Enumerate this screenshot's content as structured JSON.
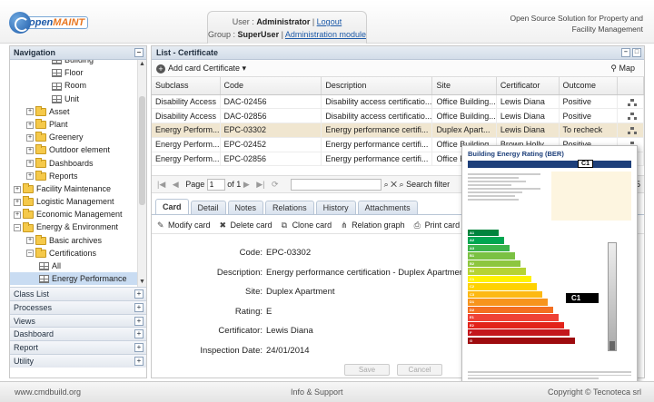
{
  "header": {
    "logo_text_a": "open",
    "logo_text_b": "MAINT",
    "user_label": "User :",
    "user_name": "Administrator",
    "logout": "Logout",
    "group_label": "Group :",
    "group_name": "SuperUser",
    "admin_link": "Administration module",
    "tagline": "Open Source Solution for Property and Facility Management"
  },
  "nav": {
    "title": "Navigation",
    "tree": [
      {
        "label": "Building",
        "type": "grid",
        "indent": 3
      },
      {
        "label": "Floor",
        "type": "grid",
        "indent": 3
      },
      {
        "label": "Room",
        "type": "grid",
        "indent": 3
      },
      {
        "label": "Unit",
        "type": "grid",
        "indent": 3
      },
      {
        "label": "Asset",
        "type": "folder",
        "indent": 1
      },
      {
        "label": "Plant",
        "type": "folder",
        "indent": 1
      },
      {
        "label": "Greenery",
        "type": "folder",
        "indent": 1
      },
      {
        "label": "Outdoor element",
        "type": "folder",
        "indent": 1
      },
      {
        "label": "Dashboards",
        "type": "folder",
        "indent": 1
      },
      {
        "label": "Reports",
        "type": "folder",
        "indent": 1
      },
      {
        "label": "Facility Maintenance",
        "type": "folder",
        "indent": 0
      },
      {
        "label": "Logistic Management",
        "type": "folder",
        "indent": 0
      },
      {
        "label": "Economic Management",
        "type": "folder",
        "indent": 0
      },
      {
        "label": "Energy & Environment",
        "type": "folder-open",
        "indent": 0
      },
      {
        "label": "Basic archives",
        "type": "folder",
        "indent": 1
      },
      {
        "label": "Certifications",
        "type": "folder-open",
        "indent": 1
      },
      {
        "label": "All",
        "type": "grid",
        "indent": 2
      },
      {
        "label": "Energy Performance",
        "type": "grid",
        "indent": 2,
        "selected": true
      }
    ],
    "accordion": [
      "Class List",
      "Processes",
      "Views",
      "Dashboard",
      "Report",
      "Utility"
    ]
  },
  "main": {
    "title": "List - Certificate",
    "add_label": "Add card Certificate",
    "map_label": "Map",
    "columns": [
      "Subclass",
      "Code",
      "Description",
      "Site",
      "Certificator",
      "Outcome"
    ],
    "rows": [
      {
        "subclass": "Disability Access",
        "code": "DAC-02456",
        "description": "Disability access certificatio...",
        "site": "Office Building...",
        "certificator": "Lewis Diana",
        "outcome": "Positive"
      },
      {
        "subclass": "Disability Access",
        "code": "DAC-02856",
        "description": "Disability access certificatio...",
        "site": "Office Building...",
        "certificator": "Lewis Diana",
        "outcome": "Positive"
      },
      {
        "subclass": "Energy Perform...",
        "code": "EPC-03302",
        "description": "Energy performance certifi...",
        "site": "Duplex Apart...",
        "certificator": "Lewis Diana",
        "outcome": "To recheck",
        "selected": true
      },
      {
        "subclass": "Energy Perform...",
        "code": "EPC-02452",
        "description": "Energy performance certifi...",
        "site": "Office Building...",
        "certificator": "Brown Holly",
        "outcome": "Positive"
      },
      {
        "subclass": "Energy Perform...",
        "code": "EPC-02856",
        "description": "Energy performance certifi...",
        "site": "Office Building...",
        "certificator": "Lewis Diana",
        "outcome": "Positive"
      }
    ],
    "pager": {
      "page_label": "Page",
      "page_value": "1",
      "of_label": "of 1",
      "search_label": "Search filter",
      "count_tail": "5"
    },
    "tabs": [
      "Card",
      "Detail",
      "Notes",
      "Relations",
      "History",
      "Attachments"
    ],
    "card_actions": [
      "Modify card",
      "Delete card",
      "Clone card",
      "Relation graph",
      "Print card"
    ],
    "form": [
      {
        "label": "Code:",
        "value": "EPC-03302"
      },
      {
        "label": "Description:",
        "value": "Energy performance certification - Duplex Apartment"
      },
      {
        "label": "Site:",
        "value": "Duplex Apartment"
      },
      {
        "label": "Rating:",
        "value": "E"
      },
      {
        "label": "Certificator:",
        "value": "Lewis Diana"
      },
      {
        "label": "Inspection Date:",
        "value": "24/01/2014"
      }
    ],
    "save": "Save",
    "cancel": "Cancel"
  },
  "certificate": {
    "title": "Building Energy Rating (BER)",
    "rating": "C1",
    "bands": [
      {
        "label": "A1",
        "color": "#00843d"
      },
      {
        "label": "A2",
        "color": "#00a651"
      },
      {
        "label": "A3",
        "color": "#3cb44b"
      },
      {
        "label": "B1",
        "color": "#7ac143"
      },
      {
        "label": "B2",
        "color": "#8dc63f"
      },
      {
        "label": "B3",
        "color": "#b5d334"
      },
      {
        "label": "C1",
        "color": "#fff200"
      },
      {
        "label": "C2",
        "color": "#ffd200"
      },
      {
        "label": "C3",
        "color": "#fdb913"
      },
      {
        "label": "D1",
        "color": "#f7941d"
      },
      {
        "label": "D2",
        "color": "#f36f21"
      },
      {
        "label": "E1",
        "color": "#ef4136"
      },
      {
        "label": "E2",
        "color": "#e2231a"
      },
      {
        "label": "F",
        "color": "#c4161c"
      },
      {
        "label": "G",
        "color": "#9e0b0f"
      }
    ]
  },
  "footer": {
    "left": "www.cmdbuild.org",
    "center": "Info & Support",
    "right": "Copyright © Tecnoteca srl"
  }
}
